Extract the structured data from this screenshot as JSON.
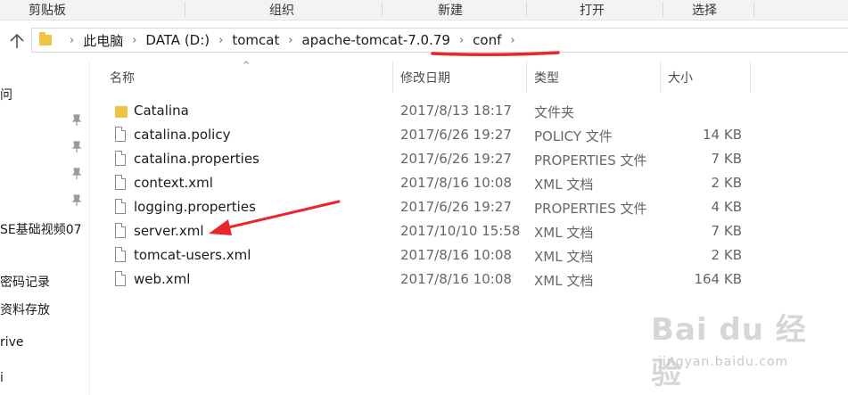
{
  "ribbon": {
    "groups": [
      "剪贴板",
      "组织",
      "新建",
      "打开",
      "选择"
    ]
  },
  "address": {
    "path": [
      "此电脑",
      "DATA (D:)",
      "tomcat",
      "apache-tomcat-7.0.79",
      "conf"
    ]
  },
  "nav": {
    "items": [
      "问",
      "SE基础视频07",
      "密码记录",
      "资料存放",
      "rive",
      "i"
    ]
  },
  "columns": {
    "name": "名称",
    "modified": "修改日期",
    "type": "类型",
    "size": "大小"
  },
  "files": [
    {
      "name": "Catalina",
      "modified": "2017/8/13 18:17",
      "type": "文件夹",
      "size": "",
      "kind": "folder"
    },
    {
      "name": "catalina.policy",
      "modified": "2017/6/26 19:27",
      "type": "POLICY 文件",
      "size": "14 KB",
      "kind": "file"
    },
    {
      "name": "catalina.properties",
      "modified": "2017/6/26 19:27",
      "type": "PROPERTIES 文件",
      "size": "7 KB",
      "kind": "file"
    },
    {
      "name": "context.xml",
      "modified": "2017/8/16 10:08",
      "type": "XML 文档",
      "size": "2 KB",
      "kind": "file"
    },
    {
      "name": "logging.properties",
      "modified": "2017/6/26 19:27",
      "type": "PROPERTIES 文件",
      "size": "4 KB",
      "kind": "file"
    },
    {
      "name": "server.xml",
      "modified": "2017/10/10 15:58",
      "type": "XML 文档",
      "size": "7 KB",
      "kind": "file"
    },
    {
      "name": "tomcat-users.xml",
      "modified": "2017/8/16 10:08",
      "type": "XML 文档",
      "size": "2 KB",
      "kind": "file"
    },
    {
      "name": "web.xml",
      "modified": "2017/8/16 10:08",
      "type": "XML 文档",
      "size": "164 KB",
      "kind": "file"
    }
  ],
  "watermark": {
    "main": "Bai du 经验",
    "sub": "jingyan.baidu.com"
  },
  "colors": {
    "folder": "#f0c443",
    "annotation": "#e8262b"
  }
}
